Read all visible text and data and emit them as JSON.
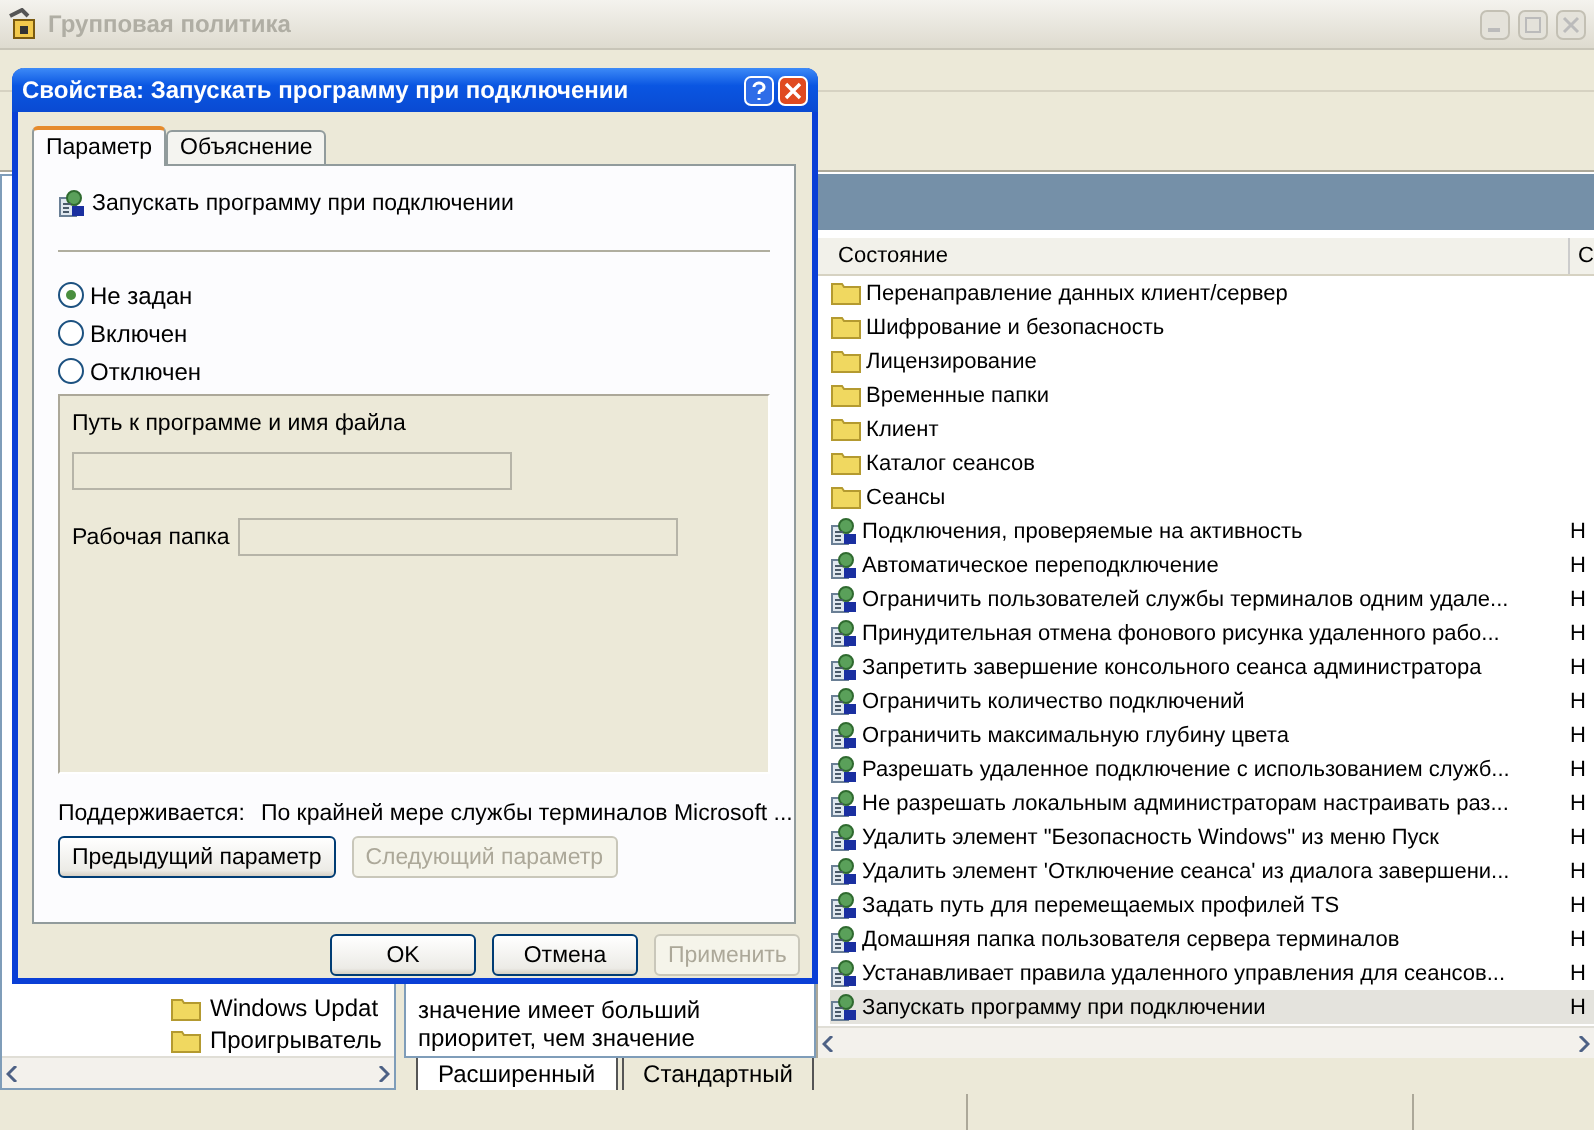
{
  "main_window": {
    "title": "Групповая политика"
  },
  "tree": {
    "items": [
      {
        "label": "Windows Updat"
      },
      {
        "label": "Проигрыватель"
      }
    ]
  },
  "description": {
    "lines": [
      "значение имеет больший",
      "приоритет, чем значение"
    ]
  },
  "view_tabs": [
    {
      "label": "Расширенный",
      "selected": true
    },
    {
      "label": "Стандартный",
      "selected": false
    }
  ],
  "list": {
    "columns": [
      "Состояние",
      "С"
    ],
    "rows": [
      {
        "kind": "folder",
        "name": "Перенаправление данных клиент/сервер",
        "selected": false
      },
      {
        "kind": "folder",
        "name": "Шифрование и безопасность",
        "selected": false
      },
      {
        "kind": "folder",
        "name": "Лицензирование",
        "selected": false
      },
      {
        "kind": "folder",
        "name": "Временные папки",
        "selected": false
      },
      {
        "kind": "folder",
        "name": "Клиент",
        "selected": false
      },
      {
        "kind": "folder",
        "name": "Каталог сеансов",
        "selected": false
      },
      {
        "kind": "folder",
        "name": "Сеансы",
        "selected": false
      },
      {
        "kind": "policy",
        "name": "Подключения, проверяемые на активность",
        "column_2": "Н",
        "selected": false
      },
      {
        "kind": "policy",
        "name": "Автоматическое переподключение",
        "column_2": "Н",
        "selected": false
      },
      {
        "kind": "policy",
        "name": "Ограничить пользователей службы терминалов одним удале...",
        "column_2": "Н",
        "selected": false
      },
      {
        "kind": "policy",
        "name": "Принудительная отмена фонового рисунка удаленного рабо...",
        "column_2": "Н",
        "selected": false
      },
      {
        "kind": "policy",
        "name": "Запретить завершение консольного сеанса администратора",
        "column_2": "Н",
        "selected": false
      },
      {
        "kind": "policy",
        "name": "Ограничить количество подключений",
        "column_2": "Н",
        "selected": false
      },
      {
        "kind": "policy",
        "name": "Ограничить максимальную глубину цвета",
        "column_2": "Н",
        "selected": false
      },
      {
        "kind": "policy",
        "name": "Разрешать удаленное подключение с использованием служб...",
        "column_2": "Н",
        "selected": false
      },
      {
        "kind": "policy",
        "name": "Не разрешать локальным администраторам настраивать раз...",
        "column_2": "Н",
        "selected": false
      },
      {
        "kind": "policy",
        "name": "Удалить элемент \"Безопасность Windows\" из меню Пуск",
        "column_2": "Н",
        "selected": false
      },
      {
        "kind": "policy",
        "name": "Удалить элемент 'Отключение сеанса' из диалога завершени...",
        "column_2": "Н",
        "selected": false
      },
      {
        "kind": "policy",
        "name": "Задать путь для перемещаемых профилей TS",
        "column_2": "Н",
        "selected": false
      },
      {
        "kind": "policy",
        "name": "Домашняя папка пользователя сервера терминалов",
        "column_2": "Н",
        "selected": false
      },
      {
        "kind": "policy",
        "name": "Устанавливает правила удаленного управления для сеансов...",
        "column_2": "Н",
        "selected": false
      },
      {
        "kind": "policy",
        "name": "Запускать программу при подключении",
        "column_2": "Н",
        "selected": true
      }
    ]
  },
  "dialog": {
    "title": "Свойства: Запускать программу при подключении",
    "tabs": [
      {
        "label": "Параметр",
        "selected": true
      },
      {
        "label": "Объяснение",
        "selected": false
      }
    ],
    "setting_title": "Запускать программу при подключении",
    "options": [
      {
        "label": "Не задан",
        "selected": true
      },
      {
        "label": "Включен",
        "selected": false
      },
      {
        "label": "Отключен",
        "selected": false
      }
    ],
    "fields": [
      {
        "kind": "stacked",
        "label": "Путь к программе и имя файла",
        "disabled": true
      },
      {
        "kind": "inline",
        "label": "Рабочая папка",
        "disabled": true
      }
    ],
    "supported_label": "Поддерживается:",
    "supported_value": "По крайней мере службы терминалов Microsoft ...",
    "nav_buttons": [
      {
        "label": "Предыдущий параметр",
        "disabled": false
      },
      {
        "label": "Следующий параметр",
        "disabled": true
      }
    ],
    "buttons": [
      {
        "label": "OK",
        "disabled": false
      },
      {
        "label": "Отмена",
        "disabled": false
      },
      {
        "label": "Применить",
        "disabled": true
      }
    ]
  }
}
